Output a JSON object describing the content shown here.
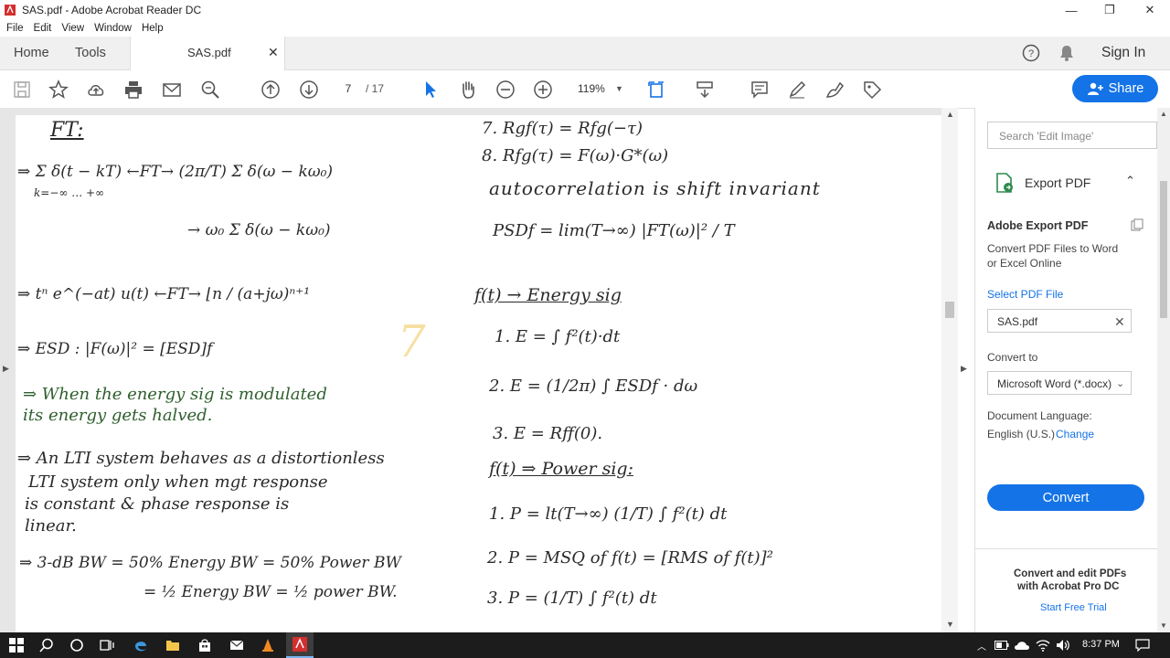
{
  "window": {
    "title": "SAS.pdf - Adobe Acrobat Reader DC",
    "controls": {
      "minimize": "—",
      "maximize": "❐",
      "close": "✕"
    }
  },
  "menu": [
    "File",
    "Edit",
    "View",
    "Window",
    "Help"
  ],
  "tabs": {
    "home": "Home",
    "tools": "Tools",
    "document": "SAS.pdf",
    "close": "✕"
  },
  "header": {
    "sign_in": "Sign In"
  },
  "toolbar": {
    "page_current": "7",
    "page_total": "/ 17",
    "zoom": "119%",
    "share": "Share"
  },
  "right_panel": {
    "search_placeholder": "Search 'Edit Image'",
    "export_title": "Export PDF",
    "adobe_export_title": "Adobe Export PDF",
    "description_line1": "Convert PDF Files to Word",
    "description_line2": "or Excel Online",
    "select_pdf_label": "Select PDF File",
    "selected_file": "SAS.pdf",
    "convert_to_label": "Convert to",
    "convert_to_value": "Microsoft Word (*.docx)",
    "doc_language_label": "Document Language:",
    "doc_language_value": "English (U.S.)",
    "change_link": "Change",
    "convert_button": "Convert",
    "promo_line1": "Convert and edit PDFs",
    "promo_line2": "with Acrobat Pro DC",
    "promo_link": "Start Free Trial"
  },
  "page_content": {
    "left": [
      "FT:",
      "⇒ Σ δ(t − kT) ←FT→ (2π/T) Σ δ(ω − kω₀)",
      "k=−∞ … +∞",
      "→ ω₀ Σ δ(ω − kω₀)",
      "⇒ tⁿ e^(−at) u(t) ←FT→ ⌊n / (a+jω)ⁿ⁺¹",
      "⇒ ESD : |F(ω)|² = [ESD]f",
      "⇒ When the energy sig is modulated",
      "its energy gets halved.",
      "⇒ An LTI system behaves as a distortionless",
      "LTI system only when mgt response",
      "is constant & phase response is",
      "linear.",
      "⇒ 3-dB BW = 50% Energy BW = 50% Power BW",
      "= ½ Energy BW = ½ power BW."
    ],
    "right": [
      "7.  Rgf(τ) = Rfg(−τ)",
      "8.  Rfg(τ) = F(ω)·G*(ω)",
      "autocorrelation is shift invariant",
      "PSDf = lim(T→∞) |FT(ω)|² / T",
      "f(t) → Energy sig",
      "1.  E = ∫ f²(t)·dt",
      "2.  E = (1/2π) ∫ ESDf · dω",
      "3.  E = Rff(0).",
      "f(t) ⇒ Power sig:",
      "1.  P = lt(T→∞) (1/T) ∫ f²(t) dt",
      "2.  P = MSQ of f(t) = [RMS of f(t)]²",
      "3.  P = (1/T) ∫ f²(t) dt"
    ],
    "page_mark": "7"
  },
  "taskbar": {
    "time": "8:37 PM"
  },
  "colors": {
    "accent": "#1473e6",
    "taskbar": "#1c1c1c",
    "doc_bg": "#e6e6e6"
  }
}
